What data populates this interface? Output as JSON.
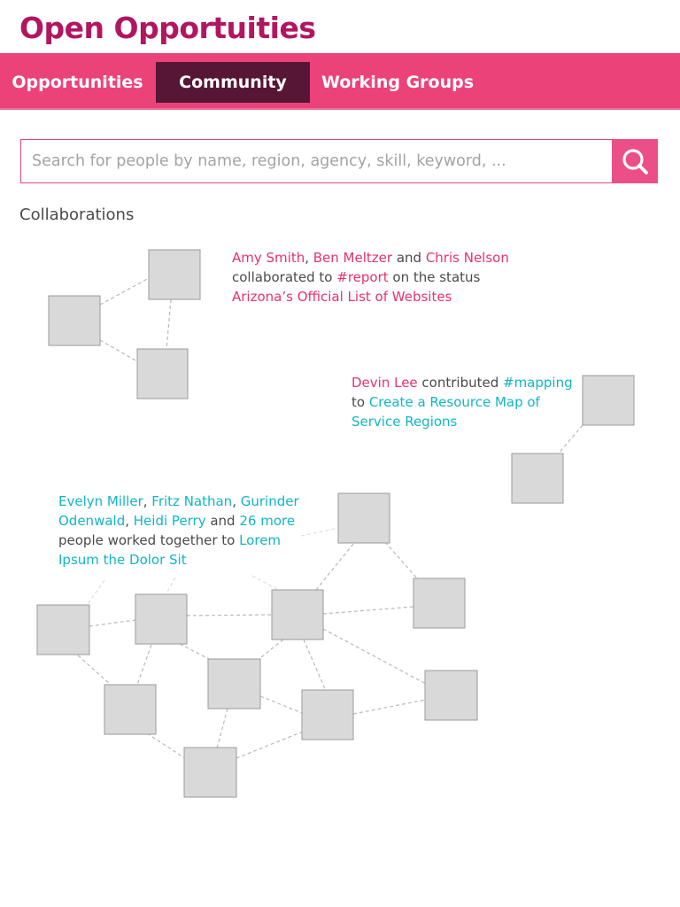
{
  "app": {
    "title": "Open Opportuities"
  },
  "nav": {
    "items": [
      {
        "label": "Opportunities",
        "active": false
      },
      {
        "label": "Community",
        "active": true
      },
      {
        "label": "Working Groups",
        "active": false
      }
    ]
  },
  "search": {
    "placeholder": "Search for people by name, region, agency, skill, keyword, ...",
    "value": "",
    "button_icon": "search-icon"
  },
  "collaborations": {
    "heading": "Collaborations",
    "items": [
      {
        "people": [
          "Amy Smith",
          "Ben Meltzer",
          "Chris Nelson"
        ],
        "sep1": ", ",
        "sep2": " and ",
        "text1": " collaborated to ",
        "tag": "#report",
        "text2": " on the status ",
        "project": "Arizona’s Official List of Websites"
      },
      {
        "person": "Devin Lee",
        "text1": " contributed ",
        "tag": "#mapping",
        "text2": " to ",
        "project": "Create a Resource Map of Service Regions"
      },
      {
        "people": [
          "Evelyn Miller",
          "Fritz Nathan",
          "Gurinder Odenwald",
          "Heidi Perry"
        ],
        "sep1": ", ",
        "sep3": " and ",
        "more": "26 more",
        "text1": " people worked together to ",
        "project": "Lorem Ipsum the Dolor Sit"
      }
    ]
  },
  "colors": {
    "brand_title": "#b11660",
    "nav_bar": "#ec427a",
    "nav_active": "#561634",
    "link_pink": "#e5326f",
    "link_teal": "#11b5c6",
    "node_fill": "#d9d9d9"
  }
}
